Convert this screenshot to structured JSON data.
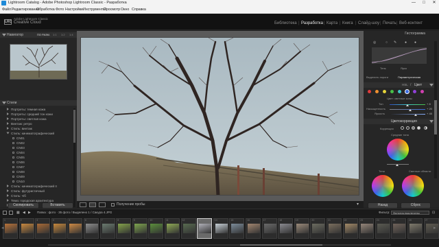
{
  "window": {
    "title": "Lightroom Catalog - Adobe Photoshop Lightroom Classic - Разработка",
    "minimize": "—",
    "maximize": "□",
    "close": "✕"
  },
  "menu": [
    "Файл",
    "Редактирование",
    "Обработка",
    "Фото",
    "Настройки",
    "Инструменты",
    "Просмотр",
    "Окно",
    "Справка"
  ],
  "brand": {
    "logo": "LRC",
    "line1": "Adobe Lightroom Classic",
    "line2": "Creative Cloud"
  },
  "modules": [
    "Библиотека",
    "Разработка",
    "Карта",
    "Книга",
    "Слайд-шоу",
    "Печать",
    "Веб-контент"
  ],
  "active_module": "Разработка",
  "navigator": {
    "title": "Навигатор",
    "options": [
      "ПО РАЗМ.",
      "1:1",
      "1:2",
      "1:4"
    ]
  },
  "presets": {
    "title": "Стили",
    "items": [
      {
        "label": "Портреты: темная кожа",
        "type": "group"
      },
      {
        "label": "Портреты: средний тон кожи",
        "type": "group"
      },
      {
        "label": "Портреты: светлая кожа",
        "type": "group"
      },
      {
        "label": "Винтаж: ретро",
        "type": "group"
      },
      {
        "label": "Стиль: винтаж",
        "type": "group"
      },
      {
        "label": "Стиль: кинематографический",
        "type": "open"
      },
      {
        "label": "CN01",
        "type": "item"
      },
      {
        "label": "CN02",
        "type": "item"
      },
      {
        "label": "CN03",
        "type": "item"
      },
      {
        "label": "CN04",
        "type": "item"
      },
      {
        "label": "CN05",
        "type": "item"
      },
      {
        "label": "CN06",
        "type": "item"
      },
      {
        "label": "CN07",
        "type": "item"
      },
      {
        "label": "CN08",
        "type": "item"
      },
      {
        "label": "CN09",
        "type": "item"
      },
      {
        "label": "CN10",
        "type": "item"
      },
      {
        "label": "Стиль: кинематографический II",
        "type": "group"
      },
      {
        "label": "Стиль: футуристичный",
        "type": "group"
      },
      {
        "label": "Стиль: ч/б",
        "type": "group"
      },
      {
        "label": "Тема: городская архитектура",
        "type": "group"
      },
      {
        "label": "Тема: еда",
        "type": "group"
      }
    ]
  },
  "left_buttons": {
    "copy": "Скопировать",
    "paste": "Вставить"
  },
  "toolbar": {
    "soft_proof": "Получение пробы"
  },
  "right_panel": {
    "histogram_title": "Гистограмма",
    "tone_curve_labels": {
      "dark": "Тень",
      "light": "Ярко"
    },
    "tone_tabs": {
      "shadows_areas": "Выделить пороги",
      "parametric": "Параметрическая"
    },
    "hsl": {
      "title": "Цвет",
      "prefix": "HSL",
      "section_label": "Цвет: светлые зоны",
      "rows": [
        {
          "label": "Тон",
          "value": "+ 8"
        },
        {
          "label": "Насыщенность",
          "value": "+ 20"
        },
        {
          "label": "Яркость",
          "value": "+ 45"
        }
      ]
    },
    "color_grading": {
      "title": "Цветокоррекция",
      "adjust": "Коррекция",
      "mid_label": "Средние тона",
      "shadows_label": "Тени",
      "highlights_label": "Светлые области"
    },
    "buttons": {
      "prev": "Назад",
      "reset": "Сброс"
    }
  },
  "filmbar": {
    "pages": [
      "1",
      "2"
    ],
    "info": "Папка : фото · 35 фото / Выделено 1 / Сакура 4.JPG",
    "filter_label": "Фильтр:",
    "filter_value": "Фильтры выключены"
  },
  "filmstrip": {
    "numbers": [
      "1",
      "2",
      "3",
      "4",
      "5",
      "6",
      "7",
      "8",
      "9",
      "10",
      "11",
      "12",
      "13",
      "14",
      "15",
      "16",
      "17",
      "18",
      "19",
      "20",
      "21",
      "22",
      "23",
      "24",
      "25",
      "26",
      "27"
    ],
    "colors": [
      "#b8733a",
      "#c9893f",
      "#a86a36",
      "#c7883c",
      "#cf8a44",
      "#8c8c8c",
      "#6b7b70",
      "#84a24a",
      "#7ea44e",
      "#5b8f3c",
      "#8faa55",
      "#586b50",
      "#b0b0b8",
      "#c6cfd6",
      "#7c8c9a",
      "#a28670",
      "#6a6a6a",
      "#8a8a90",
      "#9a8a7a",
      "#6c6c60",
      "#7b6f5e",
      "#a38a68",
      "#95867a",
      "#5a5a52",
      "#70635a",
      "#7f7a6c",
      "#5e5a50"
    ],
    "selected_index": 12
  },
  "colors": {
    "accent": "#e8e8e8",
    "panel": "#262626",
    "background": "#1d1d1d"
  }
}
